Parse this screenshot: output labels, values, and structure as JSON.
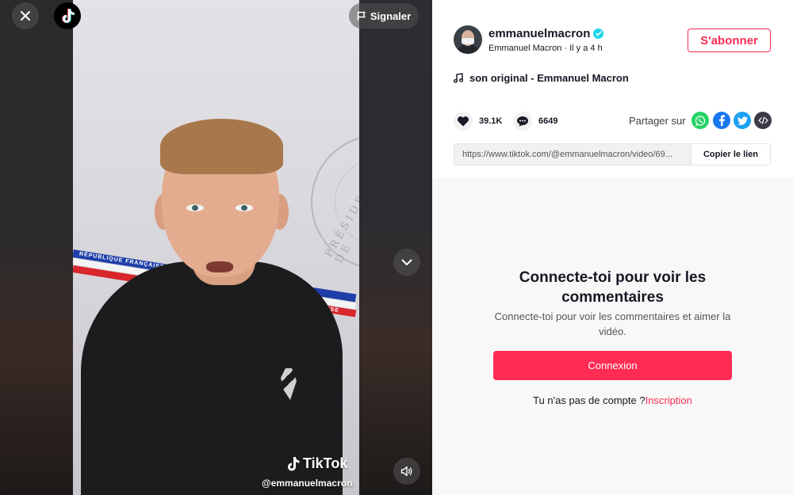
{
  "video": {
    "report_label": "Signaler",
    "watermark_brand": "TikTok",
    "watermark_handle": "@emmanuelmacron",
    "stripe_text_1": "RÉPUBLIQUE FRANÇAISE",
    "stripe_text_2": "FRANÇAISE",
    "seal_text": "PRÉSIDENCE DE"
  },
  "author": {
    "username": "emmanuelmacron",
    "display_name": "Emmanuel Macron",
    "separator": "·",
    "time_ago": "Il y a 4 h",
    "follow_label": "S'abonner"
  },
  "music": {
    "title": "son original - Emmanuel Macron"
  },
  "stats": {
    "likes": "39.1K",
    "comments": "6649"
  },
  "share": {
    "label": "Partager sur",
    "url": "https://www.tiktok.com/@emmanuelmacron/video/69...",
    "copy_label": "Copier le lien"
  },
  "login": {
    "title": "Connecte-toi pour voir les commentaires",
    "subtitle": "Connecte-toi pour voir les commentaires et aimer la vidéo.",
    "button_label": "Connexion",
    "signup_prompt": "Tu n'as pas de compte ?",
    "signup_link": "Inscription"
  },
  "colors": {
    "accent": "#fe2c55",
    "verified": "#20d5ec",
    "text": "#161823"
  }
}
